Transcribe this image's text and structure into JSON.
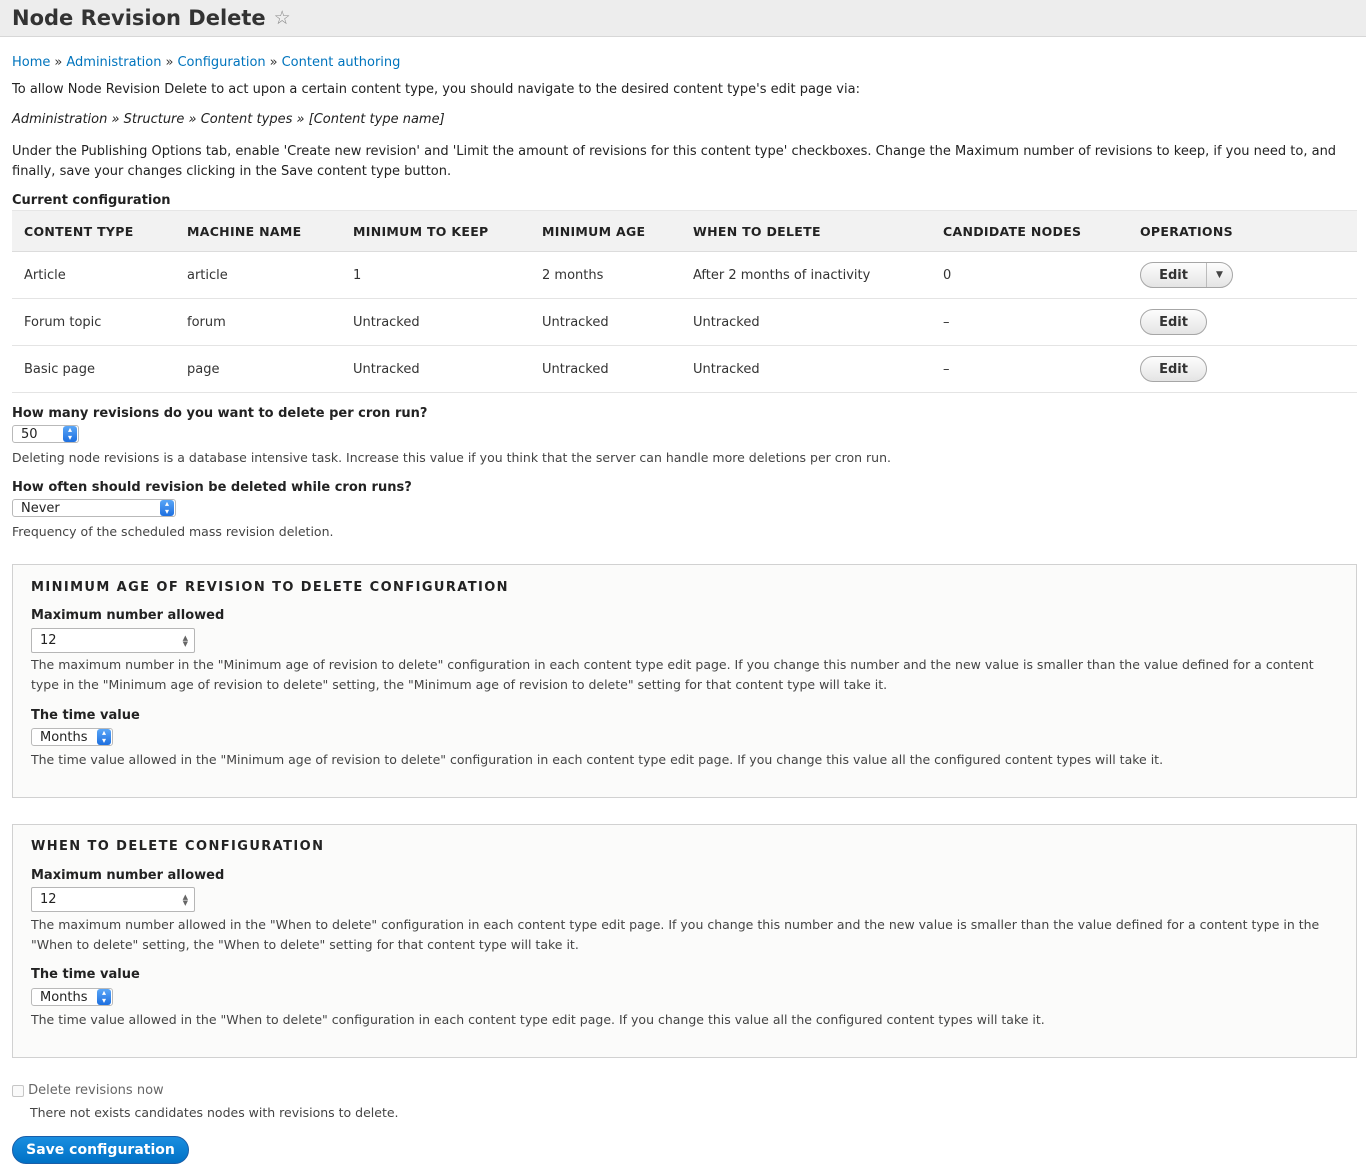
{
  "header": {
    "title": "Node Revision Delete",
    "star_icon": "star-icon"
  },
  "breadcrumb": {
    "items": [
      "Home",
      "Administration",
      "Configuration",
      "Content authoring"
    ],
    "separator": "»"
  },
  "intro": {
    "allow_text": "To allow Node Revision Delete to act upon a certain content type, you should navigate to the desired content type's edit page via:",
    "path_text": "Administration » Structure » Content types » [Content type name]",
    "under_text": "Under the Publishing Options tab, enable 'Create new revision' and 'Limit the amount of revisions for this content type' checkboxes. Change the Maximum number of revisions to keep, if you need to, and finally, save your changes clicking in the Save content type button."
  },
  "current_config": {
    "label": "Current configuration",
    "headers": [
      "CONTENT TYPE",
      "MACHINE NAME",
      "MINIMUM TO KEEP",
      "MINIMUM AGE",
      "WHEN TO DELETE",
      "CANDIDATE NODES",
      "OPERATIONS"
    ],
    "rows": [
      {
        "content_type": "Article",
        "machine_name": "article",
        "min_keep": "1",
        "min_age": "2 months",
        "when_delete": "After 2 months of inactivity",
        "candidates": "0",
        "op": "Edit"
      },
      {
        "content_type": "Forum topic",
        "machine_name": "forum",
        "min_keep": "Untracked",
        "min_age": "Untracked",
        "when_delete": "Untracked",
        "candidates": "–",
        "op": "Edit"
      },
      {
        "content_type": "Basic page",
        "machine_name": "page",
        "min_keep": "Untracked",
        "min_age": "Untracked",
        "when_delete": "Untracked",
        "candidates": "–",
        "op": "Edit"
      }
    ]
  },
  "per_cron": {
    "label": "How many revisions do you want to delete per cron run?",
    "value": "50",
    "description": "Deleting node revisions is a database intensive task. Increase this value if you think that the server can handle more deletions per cron run."
  },
  "frequency": {
    "label": "How often should revision be deleted while cron runs?",
    "value": "Never",
    "description": "Frequency of the scheduled mass revision deletion."
  },
  "min_age_config": {
    "legend": "MINIMUM AGE OF REVISION TO DELETE CONFIGURATION",
    "max_label": "Maximum number allowed",
    "max_value": "12",
    "max_desc": "The maximum number in the \"Minimum age of revision to delete\" configuration in each content type edit page. If you change this number and the new value is smaller than the value defined for a content type in the \"Minimum age of revision to delete\" setting, the \"Minimum age of revision to delete\" setting for that content type will take it.",
    "time_label": "The time value",
    "time_value": "Months",
    "time_desc": "The time value allowed in the \"Minimum age of revision to delete\" configuration in each content type edit page. If you change this value all the configured content types will take it."
  },
  "when_config": {
    "legend": "WHEN TO DELETE CONFIGURATION",
    "max_label": "Maximum number allowed",
    "max_value": "12",
    "max_desc": "The maximum number allowed in the \"When to delete\" configuration in each content type edit page. If you change this number and the new value is smaller than the value defined for a content type in the \"When to delete\" setting, the \"When to delete\" setting for that content type will take it.",
    "time_label": "The time value",
    "time_value": "Months",
    "time_desc": "The time value allowed in the \"When to delete\" configuration in each content type edit page. If you change this value all the configured content types will take it."
  },
  "delete_now": {
    "label": "Delete revisions now",
    "description": "There not exists candidates nodes with revisions to delete."
  },
  "save_button": "Save configuration",
  "colors": {
    "link": "#0074bd",
    "primary": "#0071c5"
  }
}
